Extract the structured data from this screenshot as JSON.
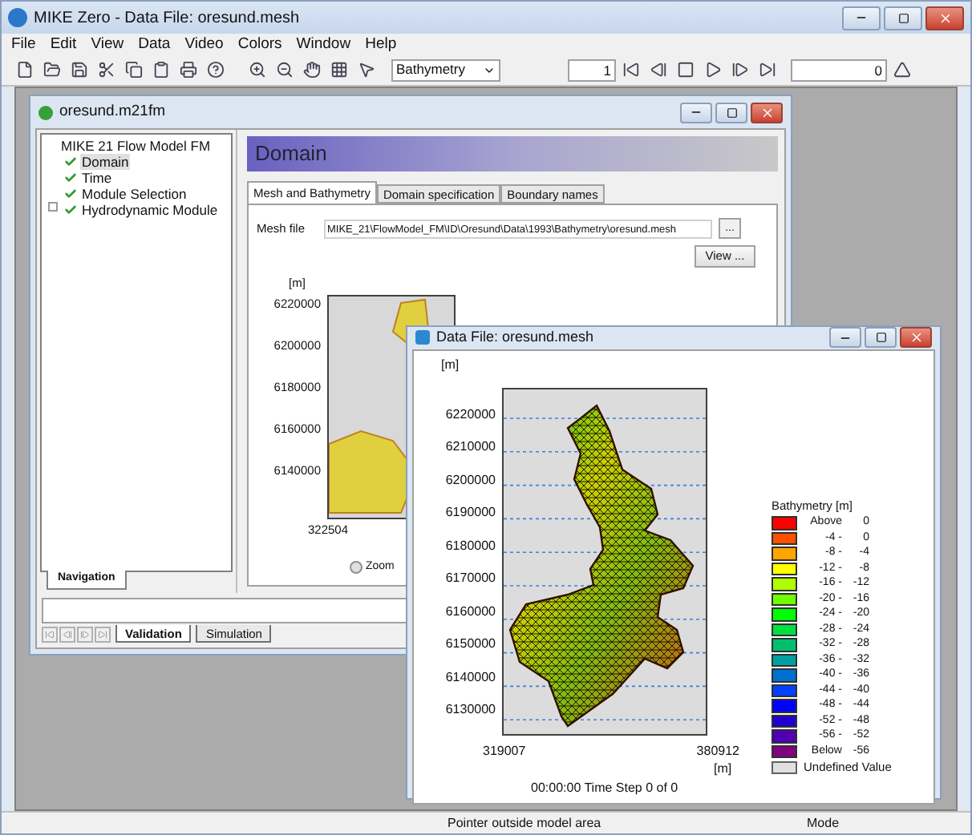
{
  "app": {
    "title": "MIKE Zero - Data File: oresund.mesh"
  },
  "menu": [
    "File",
    "Edit",
    "View",
    "Data",
    "Video",
    "Colors",
    "Window",
    "Help"
  ],
  "toolbar": {
    "item_dropdown": "Bathymetry",
    "frame_field": "1",
    "time_field": "0"
  },
  "setup_window": {
    "title": "oresund.m21fm",
    "tree": {
      "label": "MIKE 21 Flow Model FM",
      "children": [
        {
          "label": "Domain",
          "checked": true,
          "selected": true,
          "collapsed": false
        },
        {
          "label": "Time",
          "checked": true,
          "selected": false,
          "collapsed": false
        },
        {
          "label": "Module Selection",
          "checked": true,
          "selected": false,
          "collapsed": false
        },
        {
          "label": "Hydrodynamic Module",
          "checked": true,
          "selected": false,
          "collapsed": true
        }
      ]
    },
    "side_tab": "Navigation",
    "header": "Domain",
    "tabs": [
      {
        "label": "Mesh and Bathymetry",
        "selected": true
      },
      {
        "label": "Domain specification",
        "selected": false
      },
      {
        "label": "Boundary names",
        "selected": false
      }
    ],
    "mesh_label": "Mesh file",
    "mesh_value": "MIKE_21\\FlowModel_FM\\ID\\Oresund\\Data\\1993\\Bathymetry\\oresund.mesh",
    "browse_button": "...",
    "view_button": "View ...",
    "preview": {
      "unit": "[m]",
      "y_labels": [
        "6220000",
        "6200000",
        "6180000",
        "6160000",
        "6140000"
      ],
      "x_label": "322504"
    },
    "zoom_option": {
      "label": "Zoom",
      "selected": false
    },
    "bottom_tabs": [
      {
        "label": "Validation",
        "selected": true
      },
      {
        "label": "Simulation",
        "selected": false
      }
    ]
  },
  "data_window": {
    "title": "Data File: oresund.mesh",
    "y_unit": "[m]",
    "y_labels": [
      "6220000",
      "6210000",
      "6200000",
      "6190000",
      "6180000",
      "6170000",
      "6160000",
      "6150000",
      "6140000",
      "6130000"
    ],
    "x_labels": [
      "319007",
      "380912"
    ],
    "x_unit": "[m]",
    "time_step": "00:00:00 Time Step 0 of 0",
    "legend": {
      "title": "Bathymetry [m]",
      "items": [
        {
          "from": "Above",
          "to": "0",
          "color": "#ff0000"
        },
        {
          "from": "-4 -",
          "to": "0",
          "color": "#ff5000"
        },
        {
          "from": "-8 -",
          "to": "-4",
          "color": "#ffa500"
        },
        {
          "from": "-12 -",
          "to": "-8",
          "color": "#ffff00"
        },
        {
          "from": "-16 -",
          "to": "-12",
          "color": "#b0ff00"
        },
        {
          "from": "-20 -",
          "to": "-16",
          "color": "#70ff00"
        },
        {
          "from": "-24 -",
          "to": "-20",
          "color": "#00ff00"
        },
        {
          "from": "-28 -",
          "to": "-24",
          "color": "#00e040"
        },
        {
          "from": "-32 -",
          "to": "-28",
          "color": "#00c070"
        },
        {
          "from": "-36 -",
          "to": "-32",
          "color": "#00a0a0"
        },
        {
          "from": "-40 -",
          "to": "-36",
          "color": "#0070d0"
        },
        {
          "from": "-44 -",
          "to": "-40",
          "color": "#0040ff"
        },
        {
          "from": "-48 -",
          "to": "-44",
          "color": "#0000ff"
        },
        {
          "from": "-52 -",
          "to": "-48",
          "color": "#2000d0"
        },
        {
          "from": "-56 -",
          "to": "-52",
          "color": "#5000b0"
        },
        {
          "from": "Below",
          "to": "-56",
          "color": "#800080"
        }
      ],
      "undefined_label": "Undefined Value"
    }
  },
  "status_bar": {
    "message": "Pointer outside model area",
    "mode": "Mode"
  }
}
